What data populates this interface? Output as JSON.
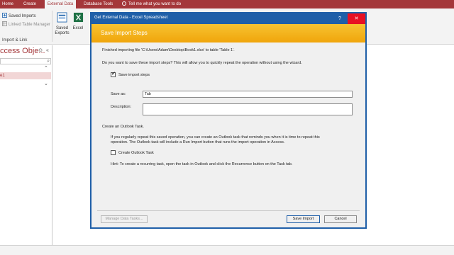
{
  "ribbon": {
    "tabs": [
      "Home",
      "Create",
      "External Data",
      "Database Tools"
    ],
    "tell_me": "Tell me what you want to do",
    "import_group": {
      "saved_imports": "Saved Imports",
      "linked_table_manager": "Linked Table Manager",
      "label": "Import & Link"
    },
    "export_group": {
      "saved_exports_line1": "Saved",
      "saved_exports_line2": "Exports",
      "excel": "Excel"
    }
  },
  "nav_pane": {
    "title": "ccess Obje...",
    "item": "e1"
  },
  "dialog": {
    "title": "Get External Data - Excel Spreadsheet",
    "help_glyph": "?",
    "close_glyph": "✕",
    "banner": "Save Import Steps",
    "finished_text": "Finished importing file 'C:\\Users\\Adam\\Desktop\\Book1.xlsx' to table 'Table 1'.",
    "question": "Do you want to save these import steps? This will allow you to quickly repeat the operation without using the wizard.",
    "save_steps_label": "Save import steps",
    "save_as_label": "Save as:",
    "save_as_value": "Tab",
    "description_label": "Description:",
    "description_value": "",
    "outlook_heading": "Create an Outlook Task.",
    "outlook_text_1": "If you regularly repeat this saved operation, you can create an Outlook task that reminds you when it is time to repeat this",
    "outlook_text_2": "operation. The Outlook task will include a Run Import button that runs the import operation in Access.",
    "outlook_task_label": "Create Outlook Task",
    "hint": "Hint: To create a recurring task, open the task in Outlook and click the Recurrence button on the Task tab.",
    "manage_tasks_button": "Manage Data Tasks...",
    "save_import_button": "Save Import",
    "cancel_button": "Cancel"
  },
  "colors": {
    "accent": "#a4373a",
    "dialog_border": "#1f5fa8",
    "banner": "#f0a50b"
  }
}
